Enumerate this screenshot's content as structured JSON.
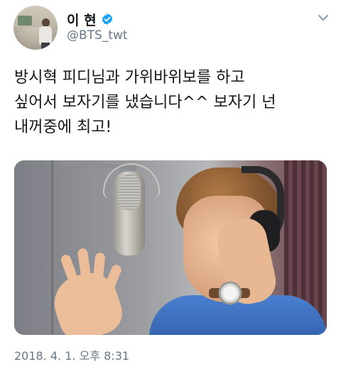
{
  "author": {
    "display_name": "이 현",
    "handle": "@BTS_twt",
    "verified": true,
    "avatar_icon": "profile-photo"
  },
  "tweet": {
    "text": "방시혁 피디님과 가위바위보를 하고\n싶어서 보자기를 냈습니다^^ 보자기 넌\n내꺼중에 최고!",
    "timestamp": "2018. 4. 1. 오후 8:31"
  },
  "media": {
    "type": "photo",
    "description_icon": "recording-studio-photo"
  },
  "icons": {
    "verified": "verified-badge-icon",
    "menu": "chevron-down-icon"
  },
  "colors": {
    "verified_blue": "#1da1f2",
    "secondary_text": "#657786",
    "primary_text": "#14171a"
  }
}
